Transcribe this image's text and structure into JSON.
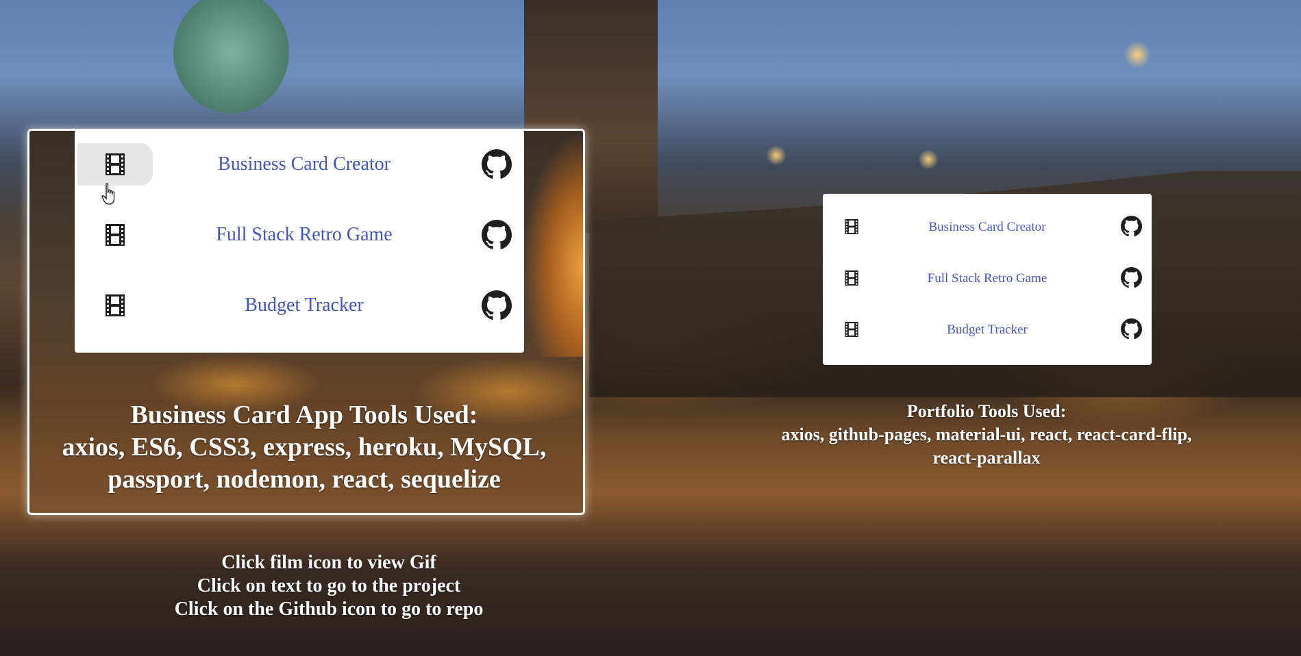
{
  "preview_panel": {
    "projects": [
      {
        "film_icon": "film-icon",
        "label": "Business Card Creator",
        "repo_icon": "github-icon"
      },
      {
        "film_icon": "film-icon",
        "label": "Full Stack Retro Game",
        "repo_icon": "github-icon"
      },
      {
        "film_icon": "film-icon",
        "label": "Budget Tracker",
        "repo_icon": "github-icon"
      }
    ],
    "tools_heading": "Business Card App Tools Used:",
    "tools_list": "axios, ES6, CSS3, express, heroku, MySQL, passport, nodemon, react, sequelize"
  },
  "portfolio_panel": {
    "projects": [
      {
        "film_icon": "film-icon",
        "label": "Business Card Creator",
        "repo_icon": "github-icon"
      },
      {
        "film_icon": "film-icon",
        "label": "Full Stack Retro Game",
        "repo_icon": "github-icon"
      },
      {
        "film_icon": "film-icon",
        "label": "Budget Tracker",
        "repo_icon": "github-icon"
      }
    ],
    "tools_heading": "Portfolio Tools Used:",
    "tools_list": "axios, github-pages, material-ui, react, react-card-flip, react-parallax"
  },
  "instructions": {
    "line1": "Click film icon to view Gif",
    "line2": "Click on text to go to the project",
    "line3": "Click on the Github icon to go to repo"
  },
  "colors": {
    "link": "#4557b4",
    "icon": "#1f1f1f",
    "hover_bg": "#e6e6e6"
  },
  "cursor": "pointer-hand-cursor"
}
